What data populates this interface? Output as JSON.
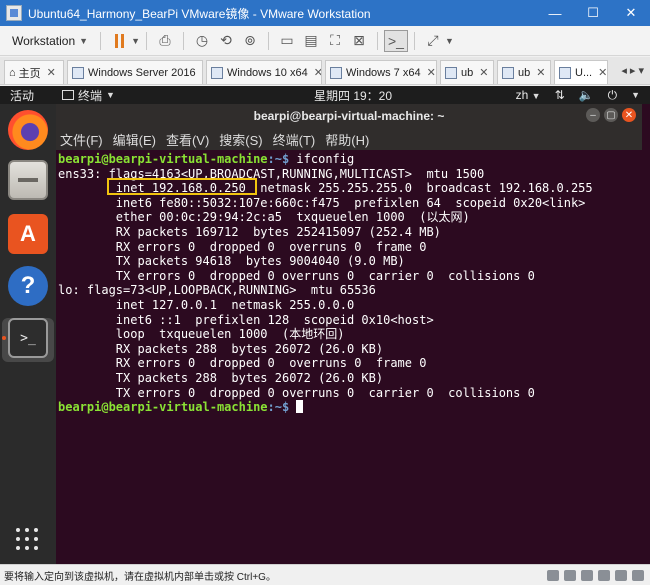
{
  "window": {
    "title": "Ubuntu64_Harmony_BearPi VMware镜像 - VMware Workstation",
    "minimize": "—",
    "maximize": "☐",
    "close": "✕"
  },
  "toolbar": {
    "workstation_label": "Workstation"
  },
  "tabs": [
    {
      "label": "主页"
    },
    {
      "label": "Windows Server 2016"
    },
    {
      "label": "Windows 10 x64"
    },
    {
      "label": "Windows 7 x64"
    },
    {
      "label": "ub"
    },
    {
      "label": "ub"
    },
    {
      "label": "U..."
    }
  ],
  "ubuntu_topbar": {
    "activities": "活动",
    "app_name": "终端",
    "clock": "星期四 19：20",
    "lang": "zh"
  },
  "terminal": {
    "title": "bearpi@bearpi-virtual-machine: ~",
    "menu": [
      "文件(F)",
      "编辑(E)",
      "查看(V)",
      "搜索(S)",
      "终端(T)",
      "帮助(H)"
    ],
    "prompt_user": "bearpi@bearpi-virtual-machine",
    "prompt_path": ":~$",
    "command": " ifconfig",
    "lines": [
      "ens33: flags=4163<UP,BROADCAST,RUNNING,MULTICAST>  mtu 1500",
      "        inet 192.168.0.250  netmask 255.255.255.0  broadcast 192.168.0.255",
      "        inet6 fe80::5032:107e:660c:f475  prefixlen 64  scopeid 0x20<link>",
      "        ether 00:0c:29:94:2c:a5  txqueuelen 1000  (以太网)",
      "        RX packets 169712  bytes 252415097 (252.4 MB)",
      "        RX errors 0  dropped 0  overruns 0  frame 0",
      "        TX packets 94618  bytes 9004040 (9.0 MB)",
      "        TX errors 0  dropped 0 overruns 0  carrier 0  collisions 0",
      "",
      "lo: flags=73<UP,LOOPBACK,RUNNING>  mtu 65536",
      "        inet 127.0.0.1  netmask 255.0.0.0",
      "        inet6 ::1  prefixlen 128  scopeid 0x10<host>",
      "        loop  txqueuelen 1000  (本地环回)",
      "        RX packets 288  bytes 26072 (26.0 KB)",
      "        RX errors 0  dropped 0  overruns 0  frame 0",
      "        TX packets 288  bytes 26072 (26.0 KB)",
      "        TX errors 0  dropped 0 overruns 0  carrier 0  collisions 0",
      ""
    ]
  },
  "status_bar": {
    "text": "要将输入定向到该虚拟机，请在虚拟机内部单击或按 Ctrl+G。"
  },
  "colors": {
    "terminal_bg": "#2c0a20",
    "prompt_user": "#8ae234",
    "prompt_path": "#729fcf",
    "highlight": "#f1c40f",
    "titlebar": "#2d73c6"
  }
}
